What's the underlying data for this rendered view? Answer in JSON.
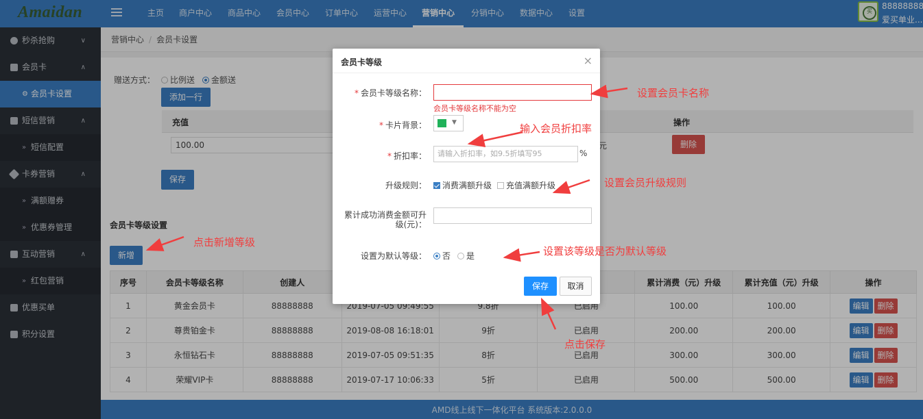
{
  "header": {
    "logo": "Amaidan",
    "nav": [
      "主页",
      "商户中心",
      "商品中心",
      "会员中心",
      "订单中心",
      "运营中心",
      "营销中心",
      "分销中心",
      "数据中心",
      "设置"
    ],
    "active_nav": "营销中心",
    "user_id": "88888888",
    "user_name": "爱买单业..."
  },
  "sidebar": {
    "items": [
      {
        "label": "秒杀抢购",
        "icon": "clock-icon"
      },
      {
        "label": "会员卡",
        "icon": "card-icon"
      },
      {
        "label": "会员卡设置",
        "icon": "gear-icon"
      },
      {
        "label": "短信营销",
        "icon": "message-icon"
      },
      {
        "label": "短信配置"
      },
      {
        "label": "卡券营销",
        "icon": "tag-icon"
      },
      {
        "label": "满额赠券"
      },
      {
        "label": "优惠券管理"
      },
      {
        "label": "互动营销",
        "icon": "interaction-icon"
      },
      {
        "label": "红包营销"
      },
      {
        "label": "优惠买单",
        "icon": "bag-icon"
      },
      {
        "label": "积分设置",
        "icon": "database-icon"
      }
    ]
  },
  "breadcrumb": [
    "营销中心",
    "会员卡设置"
  ],
  "recharge": {
    "gift_label": "赠送方式：",
    "options": [
      "比例送",
      "金额送"
    ],
    "selected": "金额送",
    "add_row": "添加一行",
    "col_recharge": "充值",
    "col_action": "操作",
    "row_value": "100.00",
    "row_unit": "元",
    "delete": "删除",
    "save": "保存"
  },
  "levels": {
    "title": "会员卡等级设置",
    "add_button": "新增",
    "columns": [
      "序号",
      "会员卡等级名称",
      "创建人",
      "",
      "",
      "",
      "累计消费（元）升级",
      "累计充值（元）升级",
      "操作"
    ],
    "rows": [
      {
        "no": "1",
        "name": "黄金会员卡",
        "creator": "88888888",
        "time": "2019-07-05 09:49:55",
        "discount": "9.8折",
        "status": "已启用",
        "consume": "100.00",
        "recharge": "100.00"
      },
      {
        "no": "2",
        "name": "尊贵铂金卡",
        "creator": "88888888",
        "time": "2019-08-08 16:18:01",
        "discount": "9折",
        "status": "已启用",
        "consume": "200.00",
        "recharge": "200.00"
      },
      {
        "no": "3",
        "name": "永恒钻石卡",
        "creator": "88888888",
        "time": "2019-07-05 09:51:35",
        "discount": "8折",
        "status": "已启用",
        "consume": "300.00",
        "recharge": "300.00"
      },
      {
        "no": "4",
        "name": "荣耀VIP卡",
        "creator": "88888888",
        "time": "2019-07-17 10:06:33",
        "discount": "5折",
        "status": "已启用",
        "consume": "500.00",
        "recharge": "500.00"
      }
    ],
    "edit": "编辑",
    "delete": "删除"
  },
  "footer": "AMD线上线下一体化平台 系统版本:2.0.0.0",
  "modal": {
    "title": "会员卡等级",
    "close": "×",
    "name_label": "会员卡等级名称：",
    "name_value": "",
    "name_error": "会员卡等级名称不能为空",
    "bg_label": "卡片背景：",
    "bg_color": "#20b25a",
    "discount_label": "折扣率：",
    "discount_placeholder": "请输入折扣率，如9.5折填写95",
    "discount_unit": "%",
    "rule_label": "升级规则：",
    "rule_options": [
      "消费满额升级",
      "充值满额升级"
    ],
    "rule_checked": [
      "消费满额升级"
    ],
    "amount_label": "累计成功消费金额可升级(元)：",
    "amount_value": "",
    "default_label": "设置为默认等级：",
    "default_options": [
      "否",
      "是"
    ],
    "default_selected": "否",
    "save": "保存",
    "cancel": "取消"
  },
  "annotations": {
    "set_name": "设置会员卡名称",
    "input_discount": "输入会员折扣率",
    "set_rule": "设置会员升级规则",
    "click_add": "点击新增等级",
    "set_default": "设置该等级是否为默认等级",
    "click_save": "点击保存",
    "color": "#f03e3e"
  }
}
